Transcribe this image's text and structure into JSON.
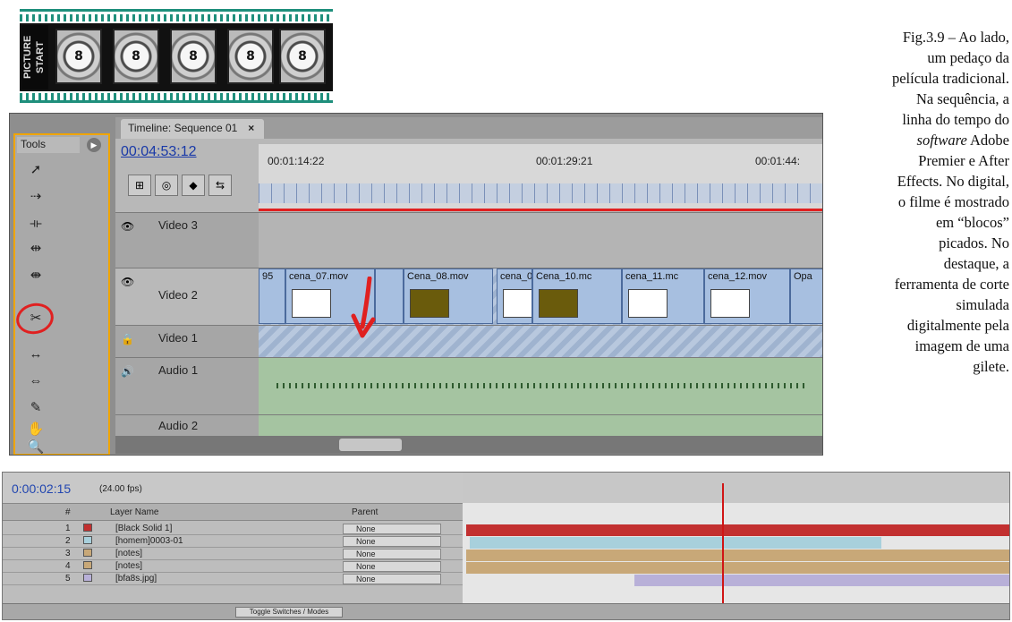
{
  "film_strip": {
    "leader_text": "PICTURE START",
    "frame_label": "8"
  },
  "caption": {
    "line1": "Fig.3.9 – Ao lado,",
    "line2": "um pedaço da",
    "line3": "película tradicional.",
    "line4": "Na sequência, a",
    "line5": "linha do tempo do",
    "line6_italic": "software",
    "line6_rest": " Adobe",
    "line7": "Premier e After",
    "line8": "Effects. No digital,",
    "line9": "o filme é mostrado",
    "line10": "em “blocos”",
    "line11": "picados. No",
    "line12": "destaque, a",
    "line13": "ferramenta de corte",
    "line14": "simulada",
    "line15": "digitalmente pela",
    "line16": "imagem de uma",
    "line17": "gilete."
  },
  "premiere": {
    "tools_tab": "Tools",
    "tools": [
      "selection-icon",
      "track-select-icon",
      "ripple-edit-icon",
      "rolling-edit-icon",
      "rate-stretch-icon",
      "razor-icon",
      "slip-icon",
      "slide-icon",
      "pen-icon",
      "hand-icon",
      "zoom-icon"
    ],
    "timeline_tab": "Timeline: Sequence 01",
    "timeline_tab_close": "×",
    "timecode": "00:04:53:12",
    "ruler_labels": [
      "00:01:14:22",
      "00:01:29:21",
      "00:01:44:"
    ],
    "tracks": {
      "video3": "Video 3",
      "video2": "Video 2",
      "video1": "Video 1",
      "audio1": "Audio 1",
      "audio2": "Audio 2"
    },
    "clips": [
      "95",
      "cena_07.mov",
      "Cena_08.mov",
      "cena_0",
      "Cena_10.mc",
      "cena_11.mc",
      "cena_12.mov",
      "Opa"
    ],
    "colors": {
      "highlight": "#f0a500",
      "marker": "#e02020",
      "clip": "#a7bfe0"
    }
  },
  "after_effects": {
    "timecode": "0:00:02:15",
    "fps": "(24.00 fps)",
    "header": {
      "num": "#",
      "layer_name": "Layer Name",
      "parent": "Parent"
    },
    "layers": [
      {
        "num": "1",
        "name": "[Black Solid 1]",
        "parent": "None",
        "color": "#c23030"
      },
      {
        "num": "2",
        "name": "[homem]0003-01",
        "parent": "None",
        "color": "#a8d0dc"
      },
      {
        "num": "3",
        "name": "[notes]",
        "parent": "None",
        "color": "#c8a878"
      },
      {
        "num": "4",
        "name": "[notes]",
        "parent": "None",
        "color": "#c8a878"
      },
      {
        "num": "5",
        "name": "[bfa8s.jpg]",
        "parent": "None",
        "color": "#b8b0d8"
      }
    ],
    "footer_toggle": "Toggle Switches / Modes"
  }
}
